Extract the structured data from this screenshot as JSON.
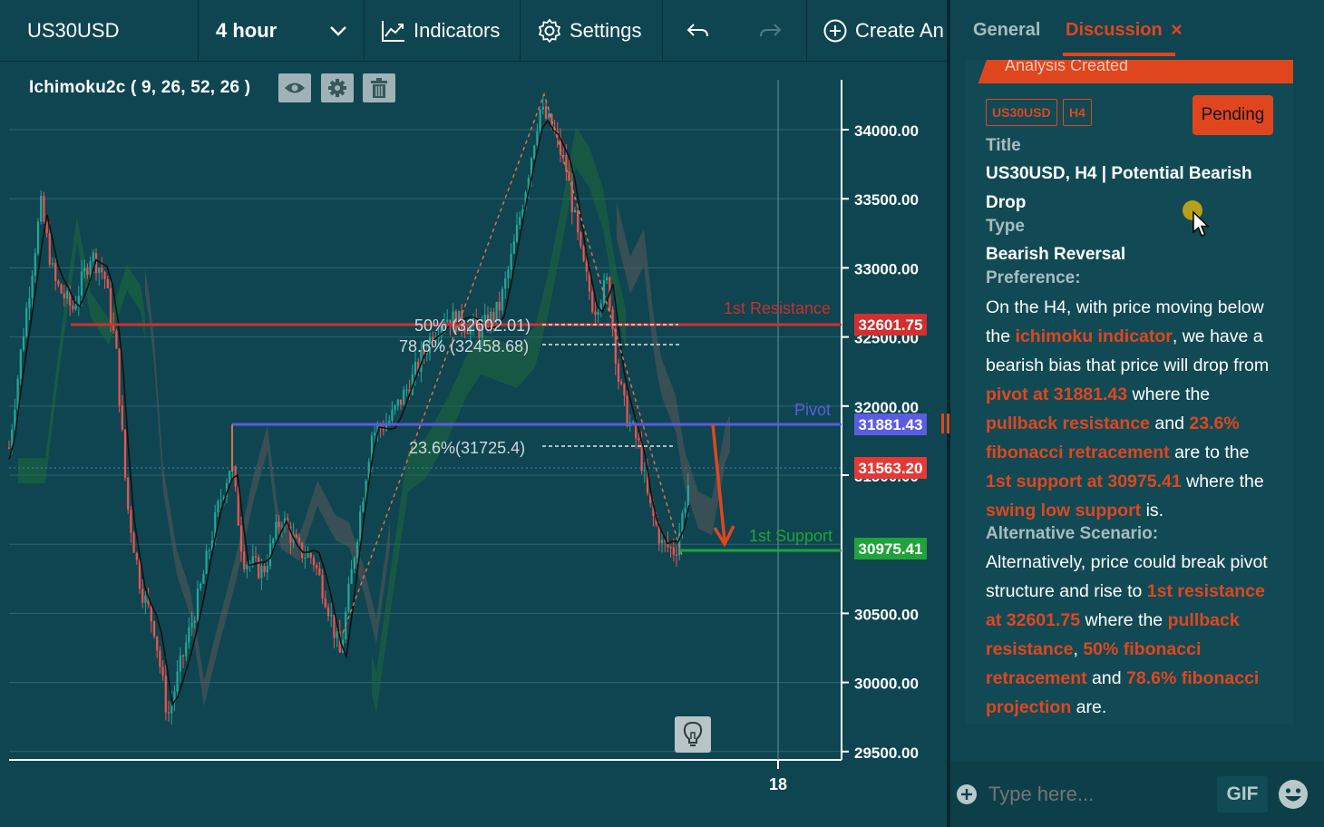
{
  "toolbar": {
    "symbol": "US30USD",
    "timeframe": "4 hour",
    "indicators_label": "Indicators",
    "settings_label": "Settings",
    "create_label": "Create An"
  },
  "chart": {
    "indicator_label": "Ichimoku2c ( 9, 26, 52, 26 )",
    "price_ticks": [
      "34000.00",
      "33500.00",
      "33000.00",
      "32500.00",
      "32000.00",
      "31500.00",
      "30500.00",
      "30000.00",
      "29500.00"
    ],
    "date_tick": "18",
    "resistance_label": "1st Resistance",
    "resistance_price": "32601.75",
    "pivot_label": "Pivot",
    "pivot_price": "31881.43",
    "current_price": "31563.20",
    "support_label": "1st Support",
    "support_price": "30975.41",
    "fib_50": "50% (32602.01)",
    "fib_786": "78.6% (32458.68)",
    "fib_236": "23.6%(31725.4)",
    "colors": {
      "resistance": "#d32f2f",
      "pivot": "#5c5ce0",
      "support": "#1fa33a",
      "current": "#e53935",
      "arrow": "#e0461e",
      "up_candle": "#26a69a",
      "down_candle": "#ef5350"
    }
  },
  "panel": {
    "tab_general": "General",
    "tab_discussion": "Discussion",
    "tab_close": "×",
    "banner": "Analysis Created",
    "tag_symbol": "US30USD",
    "tag_tf": "H4",
    "status": "Pending",
    "title_label": "Title",
    "title_value": "US30USD, H4 | Potential Bearish Drop",
    "type_label": "Type",
    "type_value": "Bearish Reversal",
    "preference_label": "Preference:",
    "pref": {
      "t1": "On the H4, with price moving below the ",
      "h1": "ichimoku indicator",
      "t2": ", we have a bearish bias that price will drop from ",
      "h2": "pivot at 31881.43",
      "t3": " where the ",
      "h3": "pullback resistance",
      "t4": " and ",
      "h4": "23.6% fibonacci retracement",
      "t5": " are to the ",
      "h5": "1st support at 30975.41",
      "t6": " where the ",
      "h6": "swing low support",
      "t7": " is."
    },
    "alt_label": "Alternative Scenario:",
    "alt": {
      "t1": "Alternatively, price could break pivot structure and rise to ",
      "h1": "1st resistance at 32601.75",
      "t2": " where the ",
      "h2": "pullback resistance",
      "t3": ", ",
      "h3": "50% fibonacci retracement",
      "t4": " and ",
      "h4": "78.6% fibonacci projection",
      "t5": " are."
    },
    "input_placeholder": "Type here...",
    "gif_label": "GIF"
  }
}
